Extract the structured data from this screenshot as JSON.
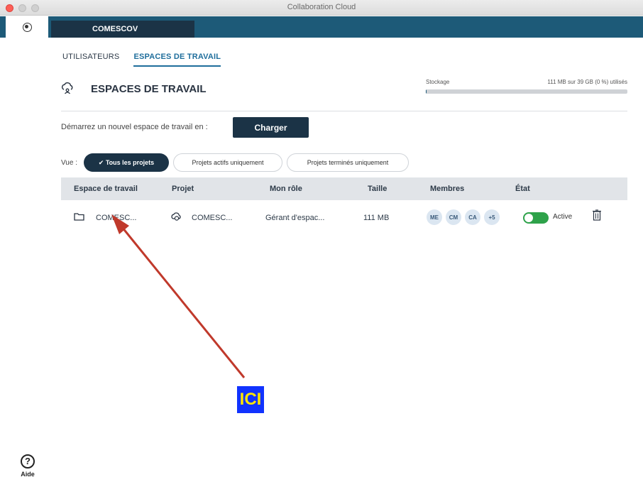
{
  "window": {
    "title": "Collaboration Cloud"
  },
  "tabs": {
    "active_workspace": "COMESCOV"
  },
  "subtabs": [
    "UTILISATEURS",
    "ESPACES DE TRAVAIL"
  ],
  "header": {
    "title": "ESPACES DE TRAVAIL",
    "storage_label": "Stockage",
    "storage_value": "111 MB sur 39 GB (0 %) utilisés",
    "storage_used_fraction": 0.003
  },
  "start": {
    "label": "Démarrez un nouvel espace de travail en :",
    "button": "Charger"
  },
  "filters": {
    "vue_label": "Vue :",
    "all": "✔ Tous les projets",
    "active": "Projets actifs uniquement",
    "finished": "Projets terminés uniquement"
  },
  "table": {
    "headers": [
      "Espace de travail",
      "Projet",
      "Mon rôle",
      "Taille",
      "Membres",
      "État"
    ],
    "row": {
      "workspace": "COMESC...",
      "project": "COMESC...",
      "role": "Gérant d'espac...",
      "size": "111 MB",
      "members": [
        "ME",
        "CM",
        "CA",
        "+5"
      ],
      "state": "Active"
    }
  },
  "annotation": {
    "label": "ICI",
    "arrow_color": "#c0392b",
    "box_color": "#1133ff",
    "text_color": "#ffe600"
  },
  "help": {
    "label": "Aide"
  },
  "colors": {
    "accent": "#1d5a78",
    "dark": "#1b3346",
    "active_link": "#1f6e9c",
    "toggle_on": "#2ea24a"
  }
}
